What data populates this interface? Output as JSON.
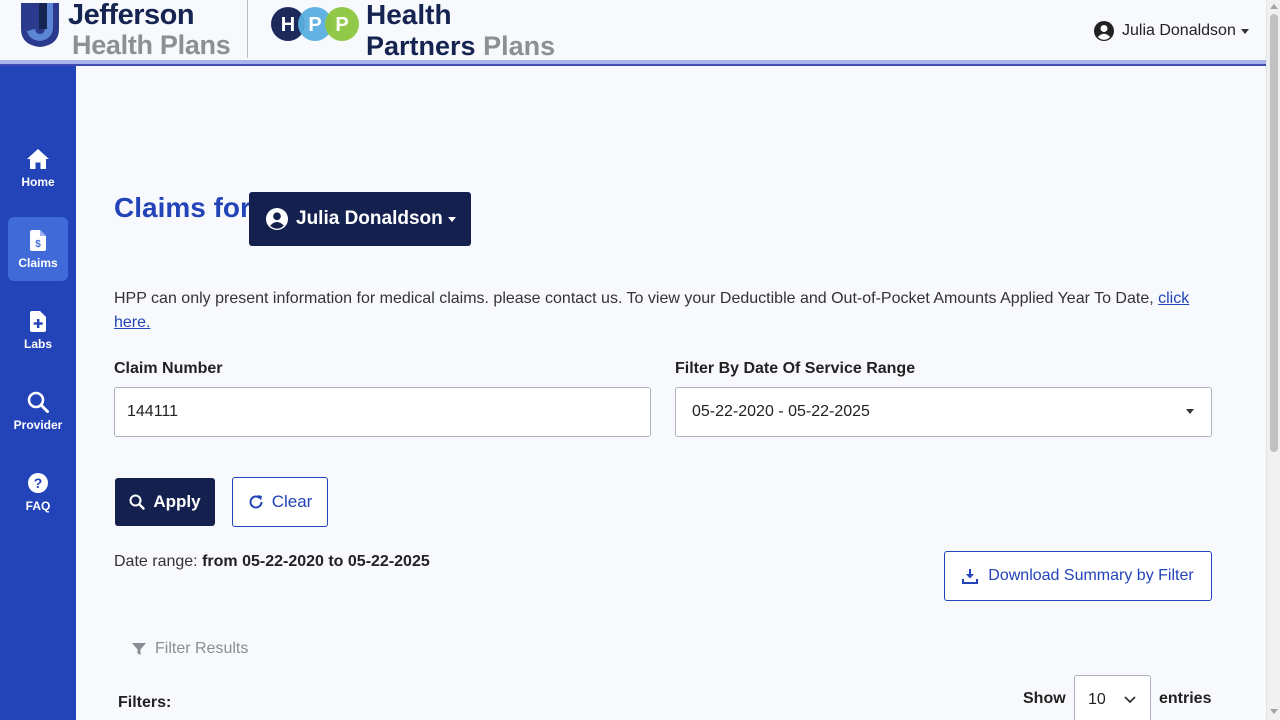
{
  "header": {
    "jefferson_line1": "Jefferson",
    "jefferson_line2": "Health Plans",
    "hpp_letters": [
      "H",
      "P",
      "P"
    ],
    "hpp_line1": "Health",
    "hpp_line2_a": "Partners",
    "hpp_line2_b": "Plans",
    "user_name": "Julia Donaldson"
  },
  "sidebar": {
    "items": [
      {
        "label": "Home",
        "icon": "home-icon",
        "active": false
      },
      {
        "label": "Claims",
        "icon": "claims-icon",
        "active": true
      },
      {
        "label": "Labs",
        "icon": "labs-icon",
        "active": false
      },
      {
        "label": "Provider",
        "icon": "search-icon",
        "active": false
      },
      {
        "label": "FAQ",
        "icon": "question-icon",
        "active": false
      }
    ]
  },
  "main": {
    "title": "Claims for",
    "member_name": "Julia Donaldson",
    "info_text": "HPP can only present information for medical claims. please contact us. To view your Deductible and Out-of-Pocket Amounts Applied Year To Date,",
    "info_link": "click here.",
    "claim_number_label": "Claim Number",
    "claim_number_value": "144111",
    "date_filter_label": "Filter By Date Of Service Range",
    "date_filter_value": "05-22-2020 - 05-22-2025",
    "apply_label": "Apply",
    "clear_label": "Clear",
    "date_range_prefix": "Date range:",
    "date_range_value": "from 05-22-2020 to 05-22-2025",
    "download_label": "Download Summary by Filter",
    "filter_results_label": "Filter Results",
    "filters_label": "Filters:",
    "show_label": "Show",
    "entries_value": "10",
    "entries_label": "entries"
  },
  "colors": {
    "brand_navy": "#14214f",
    "sidebar_blue": "#2344b8",
    "active_nav": "#3f6ad8",
    "hpp_circle_1": "#1d2a5c",
    "hpp_circle_2": "#5aaee0",
    "hpp_circle_3": "#8cc63f"
  }
}
